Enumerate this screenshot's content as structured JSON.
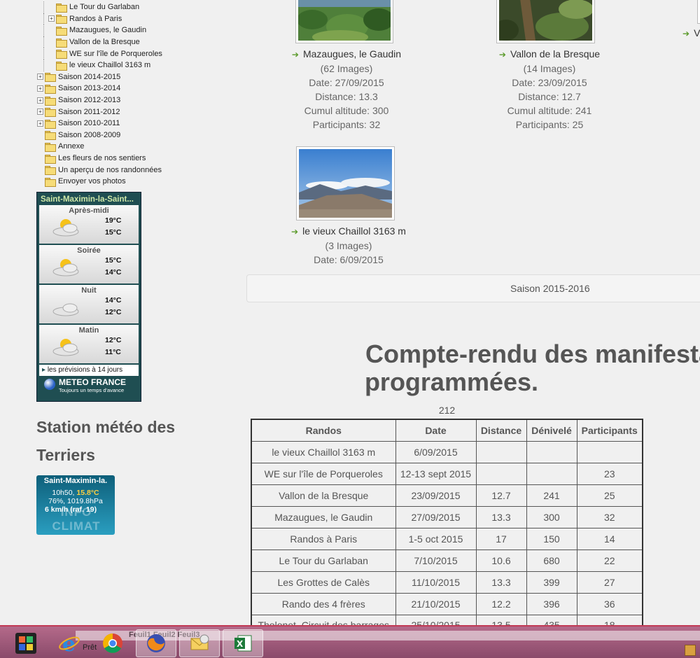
{
  "tree": [
    {
      "label": "Le Tour du Garlaban",
      "level": 2,
      "expander": false
    },
    {
      "label": "Randos à Paris",
      "level": 2,
      "expander": true
    },
    {
      "label": "Mazaugues, le Gaudin",
      "level": 2,
      "expander": false
    },
    {
      "label": "Vallon de la Bresque",
      "level": 2,
      "expander": false
    },
    {
      "label": "WE sur l'île de Porqueroles",
      "level": 2,
      "expander": false
    },
    {
      "label": "le vieux Chaillol 3163 m",
      "level": 2,
      "expander": false
    },
    {
      "label": "Saison 2014-2015",
      "level": 1,
      "expander": true
    },
    {
      "label": "Saison 2013-2014",
      "level": 1,
      "expander": true
    },
    {
      "label": "Saison 2012-2013",
      "level": 1,
      "expander": true
    },
    {
      "label": "Saison 2011-2012",
      "level": 1,
      "expander": true
    },
    {
      "label": "Saison 2010-2011",
      "level": 1,
      "expander": true
    },
    {
      "label": "Saison 2008-2009",
      "level": 1,
      "expander": false
    },
    {
      "label": "Annexe",
      "level": 1,
      "expander": false
    },
    {
      "label": "Les fleurs de nos sentiers",
      "level": 1,
      "expander": false
    },
    {
      "label": "Un aperçu de nos randonnées",
      "level": 1,
      "expander": false
    },
    {
      "label": "Envoyer vos photos",
      "level": 1,
      "expander": false
    }
  ],
  "meteo": {
    "title": "Saint-Maximin-la-Saint...",
    "periods": [
      {
        "label": "Après-midi",
        "max": "19°C",
        "min": "15°C",
        "icon": "sun-cloud-icon"
      },
      {
        "label": "Soirée",
        "max": "15°C",
        "min": "14°C",
        "icon": "sun-cloud-icon"
      },
      {
        "label": "Nuit",
        "max": "14°C",
        "min": "12°C",
        "icon": "cloud-icon"
      },
      {
        "label": "Matin",
        "max": "12°C",
        "min": "11°C",
        "icon": "sun-cloud-icon"
      }
    ],
    "link": "les prévisions à 14 jours",
    "brand": "METEO FRANCE",
    "slogan": "Toujours un temps d'avance"
  },
  "station": {
    "title": "Station météo des Terriers"
  },
  "infoclimat": {
    "name": "Saint-Maximin-la.",
    "time": "10h50,",
    "temp": "15.8°C",
    "humidity_pressure": "76%, 1019.8hPa",
    "wind": "6 km/h (raf. 19)",
    "watermark": "INFO CLIMAT"
  },
  "albums": [
    {
      "name": "Mazaugues, le Gaudin",
      "images": "(62 Images)",
      "date": "Date: 27/09/2015",
      "distance": "Distance: 13.3",
      "cumul": "Cumul altitude: 300",
      "participants": "Participants: 32"
    },
    {
      "name": "Vallon de la Bresque",
      "images": "(14 Images)",
      "date": "Date: 23/09/2015",
      "distance": "Distance: 12.7",
      "cumul": "Cumul altitude: 241",
      "participants": "Participants: 25"
    },
    {
      "name": "le vieux Chaillol 3163 m",
      "images": "(3 Images)",
      "date": "Date: 6/09/2015"
    }
  ],
  "edge_letter": "V",
  "saison_bar": "Saison 2015-2016",
  "compte_rendu": {
    "line1": "Compte-rendu des manifesta",
    "line2": "programmées."
  },
  "count": "212",
  "table": {
    "headers": [
      "Randos",
      "Date",
      "Distance",
      "Dénivelé",
      "Participants"
    ],
    "rows": [
      [
        "le vieux Chaillol 3163 m",
        "6/09/2015",
        "",
        "",
        ""
      ],
      [
        "WE sur l'île de Porqueroles",
        "12-13 sept 2015",
        "",
        "",
        "23"
      ],
      [
        "Vallon de la Bresque",
        "23/09/2015",
        "12.7",
        "241",
        "25"
      ],
      [
        "Mazaugues, le Gaudin",
        "27/09/2015",
        "13.3",
        "300",
        "32"
      ],
      [
        "Randos à Paris",
        "1-5 oct 2015",
        "17",
        "150",
        "14"
      ],
      [
        "Le Tour du Garlaban",
        "7/10/2015",
        "10.6",
        "680",
        "22"
      ],
      [
        "Les Grottes de Calès",
        "11/10/2015",
        "13.3",
        "399",
        "27"
      ],
      [
        "Rando des 4 frères",
        "21/10/2015",
        "12.2",
        "396",
        "36"
      ],
      [
        "Tholonet, Circuit des barrages",
        "25/10/2015",
        "13.5",
        "435",
        "18"
      ]
    ]
  },
  "taskbar": {
    "status": "Prêt",
    "sheet_tabs": "Feuil1  Feuil2  Feuil3",
    "apps": [
      "puzzle-app-icon",
      "internet-explorer-icon",
      "chrome-icon",
      "firefox-icon",
      "outlook-icon",
      "excel-icon"
    ]
  }
}
